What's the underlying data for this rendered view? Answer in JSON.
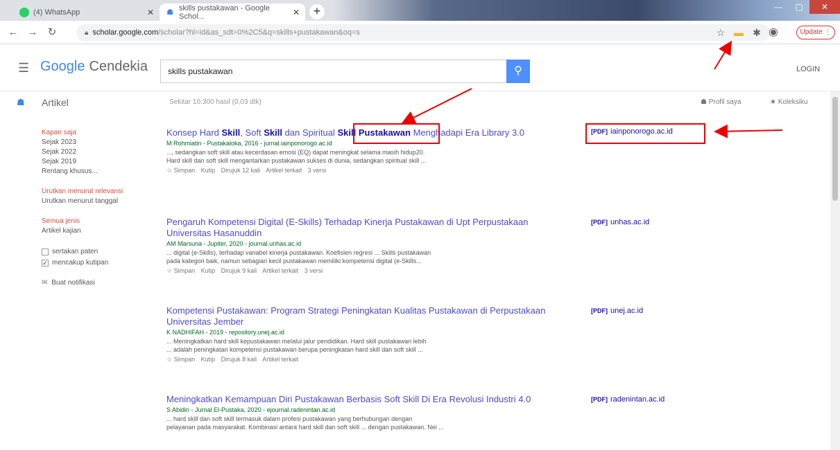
{
  "browser": {
    "tabs": [
      {
        "label": "(4) WhatsApp"
      },
      {
        "label": "skills pustakawan - Google Schol..."
      }
    ],
    "url_domain": "scholar.google.com",
    "url_path": "/scholar?hl=id&as_sdt=0%2C5&q=skills+pustakawan&oq=s",
    "update_label": "Update"
  },
  "scholar": {
    "logo_google": "Google",
    "logo_cendekia": "Cendekia",
    "search_value": "skills pustakawan",
    "login": "LOGIN",
    "section": "Artikel",
    "result_count": "Sekitar 10.300 hasil (0,03 dtk)",
    "profil": "Profil saya",
    "koleksi": "Koleksiku"
  },
  "sidebar": {
    "time": [
      "Kapan saja",
      "Sejak 2023",
      "Sejak 2022",
      "Sejak 2019",
      "Rentang khusus..."
    ],
    "sort": [
      "Urutkan menurut relevansi",
      "Urutkan menurut tanggal"
    ],
    "type": [
      "Semua jenis",
      "Artikel kajian"
    ],
    "checks": [
      "sertakan paten",
      "mencakup kutipan"
    ],
    "notif": "Buat notifikasi"
  },
  "results": [
    {
      "title_a": "Konsep Hard ",
      "title_b1": "Skill",
      "title_c": ", Soft ",
      "title_b2": "Skill",
      "title_d": " dan Spiritual ",
      "title_b3": "Skill Pustakawan",
      "title_e": " Menghadapi Era Library 3.0",
      "meta": "M Rohmiatin - Pustakaloka, 2016 - jurnal.iainponorogo.ac.id",
      "snippet1": "..., sedangkan soft skill atau kecerdasan emosi (EQ) dapat meningkat selama masih hidup20.",
      "snippet2": "Hard skill dan soft skill mengantarkan pustakawan sukses di dunia, sedangkan spiritual skill ...",
      "actions": [
        "☆ Simpan",
        "Kutip",
        "Dirujuk 12 kali",
        "Artikel terkait",
        "3 versi"
      ],
      "pdf_domain": "iainponorogo.ac.id"
    },
    {
      "title": "Pengaruh Kompetensi Digital (E-Skills) Terhadap Kinerja Pustakawan di Upt Perpustakaan Universitas Hasanuddin",
      "meta": "AM Marsuna - Jupiter, 2020 - journal.unhas.ac.id",
      "snippet1": "... digital (e-Skills), terhadap variabel kinerja pustakawan. Koefisien regresi ... Skills pustakawan",
      "snippet2": "pada kategori baik, namun sebagian kecil pustakawan memiliki kompetensi digital (e-Skills...",
      "actions": [
        "☆ Simpan",
        "Kutip",
        "Dirujuk 9 kali",
        "Artikel terkait",
        "3 versi"
      ],
      "pdf_domain": "unhas.ac.id"
    },
    {
      "title": "Kompetensi Pustakawan: Program Strategi Peningkatan Kualitas Pustakawan di Perpustakaan Universitas Jember",
      "meta": "K NADHIFAH - 2019 - repository.unej.ac.id",
      "snippet1": "... Meningkatkan hard skill kepustakawan melalui jalur pendidikan. Hard skill pustakawan lebih",
      "snippet2": "... adalah peningkatan kompetensi pustakawan berupa peningkatan hard skill dan soft skill ...",
      "actions": [
        "☆ Simpan",
        "Kutip",
        "Dirujuk 8 kali",
        "Artikel terkait"
      ],
      "pdf_domain": "unej.ac.id"
    },
    {
      "title": "Meningkatkan Kemampuan Diri Pustakawan Berbasis Soft Skill Di Era Revolusi Industri 4.0",
      "meta": "S Abidin - Jurnal El-Pustaka, 2020 - ejournal.radenintan.ac.id",
      "snippet1": "... hard skill dan soft skill termasuk dalam profesi pustakawan yang berhubungan dengan",
      "snippet2": "pelayanan pada masyarakat. Kombinasi antara hard skill dan soft skill ... dengan pustakawan. Nei ...",
      "pdf_domain": "radenintan.ac.id"
    }
  ],
  "pdf_tag": "[PDF]"
}
